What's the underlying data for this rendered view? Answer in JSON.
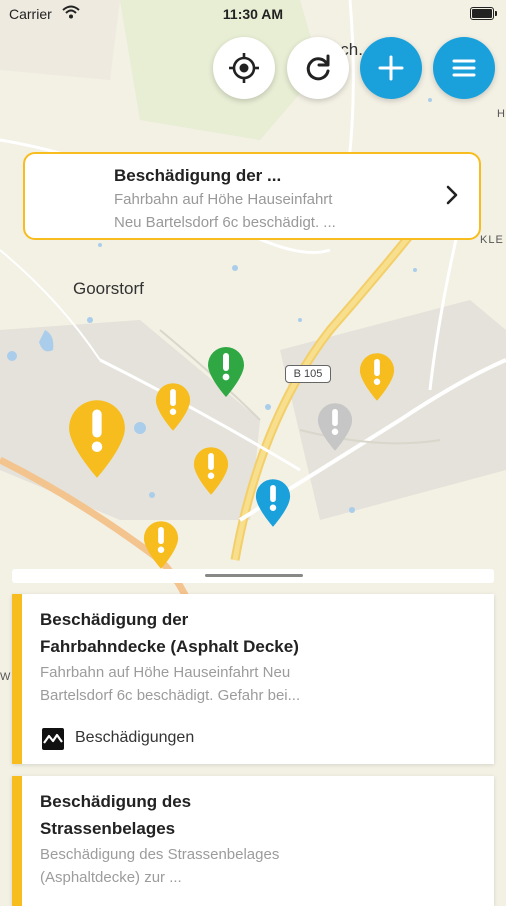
{
  "status": {
    "carrier": "Carrier",
    "time": "11:30 AM"
  },
  "map": {
    "places": {
      "goorstorf": "Goorstorf",
      "top_place": "isch...orf",
      "h": "H",
      "kle": "KLE",
      "w": "W"
    },
    "road_label": "B 105",
    "pins": [
      {
        "name": "pin-green",
        "color": "#2fa844"
      },
      {
        "name": "pin-yellow-large",
        "color": "#f7bd1e"
      },
      {
        "name": "pin-yellow",
        "color": "#f7bd1e"
      },
      {
        "name": "pin-grey",
        "color": "#c6c6c6"
      },
      {
        "name": "pin-blue",
        "color": "#1aa1dc"
      }
    ]
  },
  "toolbar": {
    "locate_icon": "crosshair-icon",
    "refresh_icon": "refresh-icon",
    "add_icon": "plus-icon",
    "menu_icon": "menu-icon"
  },
  "selected": {
    "title": "Beschädigung der ...",
    "line1": "Fahrbahn auf Höhe Hauseinfahrt",
    "line2": "Neu Bartelsdorf 6c beschädigt. ..."
  },
  "list": [
    {
      "title1": "Beschädigung der",
      "title2": "Fahrbahndecke (Asphalt Decke)",
      "desc1": "Fahrbahn auf Höhe Hauseinfahrt Neu",
      "desc2": "Bartelsdorf 6c beschädigt. Gefahr bei...",
      "category": "Beschädigungen"
    },
    {
      "title1": "Beschädigung des",
      "title2": "Strassenbelages",
      "desc1": "Beschädigung des Strassenbelages",
      "desc2": "(Asphaltdecke) zur ..."
    }
  ],
  "colors": {
    "accent": "#f7bd1e",
    "brand_blue": "#1aa1dc"
  }
}
